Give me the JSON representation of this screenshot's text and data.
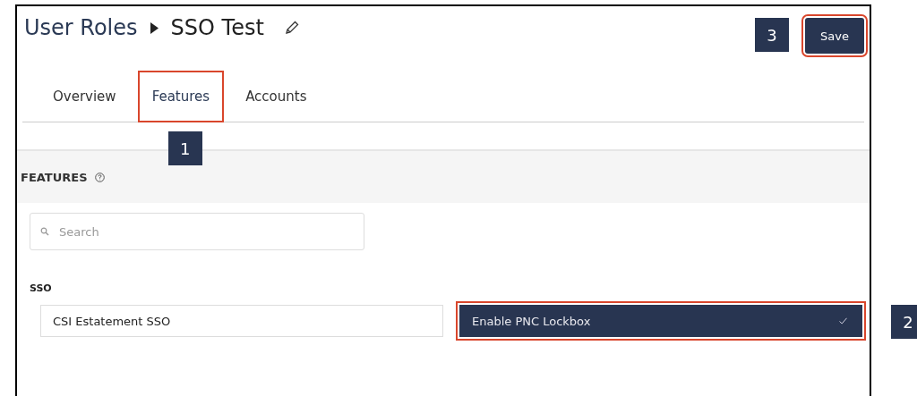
{
  "breadcrumb": {
    "parent": "User Roles",
    "current": "SSO Test"
  },
  "save_button": {
    "label": "Save",
    "highlighted": true,
    "callout": "3"
  },
  "tabs": [
    {
      "label": "Overview",
      "selected": false,
      "highlighted": false
    },
    {
      "label": "Features",
      "selected": true,
      "highlighted": true,
      "callout": "1"
    },
    {
      "label": "Accounts",
      "selected": false,
      "highlighted": false
    }
  ],
  "section": {
    "title": "FEATURES"
  },
  "search": {
    "placeholder": "Search"
  },
  "group": {
    "title": "SSO",
    "features": [
      {
        "label": "CSI Estatement SSO",
        "checked": false,
        "highlighted": false
      },
      {
        "label": "Enable PNC Lockbox",
        "checked": true,
        "highlighted": true,
        "callout": "2"
      }
    ]
  }
}
